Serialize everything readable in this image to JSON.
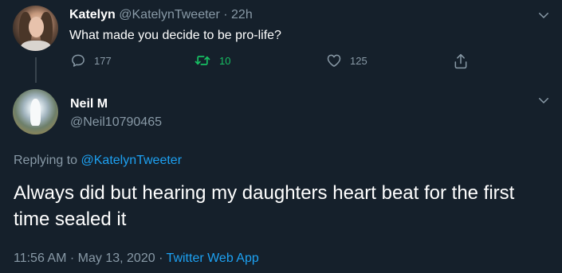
{
  "parent_tweet": {
    "name": "Katelyn",
    "handle": "@KatelynTweeter",
    "separator": "·",
    "time": "22h",
    "text": "What made you decide to be pro-life?",
    "replies": "177",
    "retweets": "10",
    "likes": "125"
  },
  "main_tweet": {
    "name": "Neil M",
    "handle": "@Neil10790465",
    "replying_prefix": "Replying to",
    "replying_to": "@KatelynTweeter",
    "text": "Always did but hearing my daughters heart beat for the first time sealed it",
    "time": "11:56 AM",
    "dot1": "·",
    "date": "May 13, 2020",
    "dot2": "·",
    "source": "Twitter Web App"
  },
  "colors": {
    "background": "#15202b",
    "text_primary": "#ffffff",
    "text_muted": "#8899a6",
    "link": "#1da1f2",
    "retweet_active": "#17bf63",
    "thread_line": "#38444d"
  },
  "icons": {
    "reply": "reply-icon",
    "retweet": "retweet-icon",
    "like": "heart-icon",
    "share": "share-icon",
    "menu": "chevron-down-icon"
  }
}
